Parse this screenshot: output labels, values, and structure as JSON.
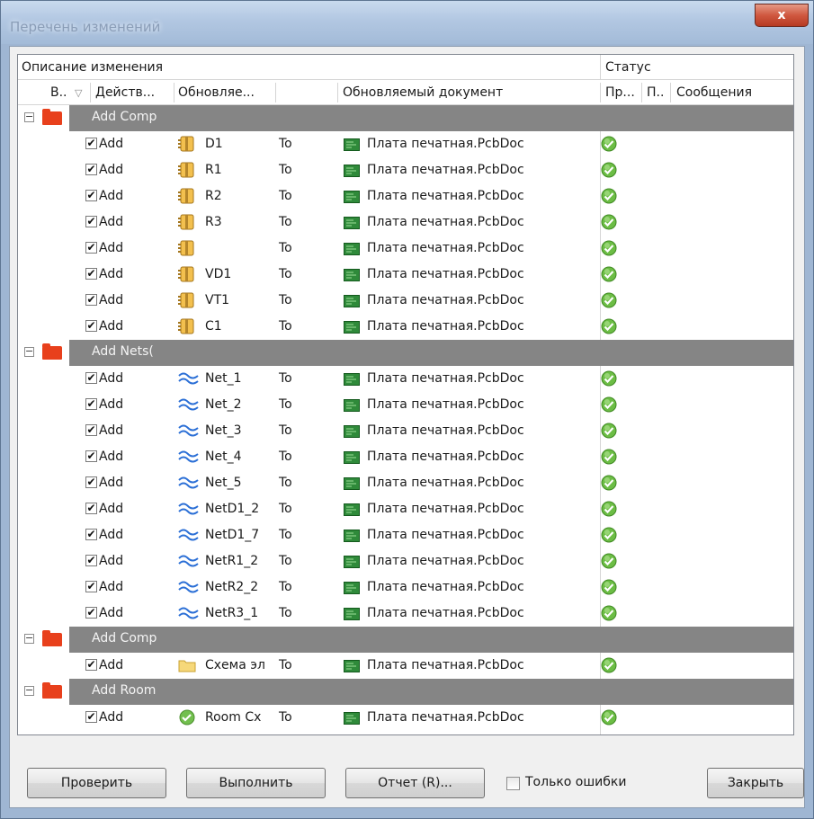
{
  "window": {
    "title": "Перечень изменений",
    "close_glyph": "x"
  },
  "bands": {
    "left": "Описание изменения",
    "right": "Статус"
  },
  "columns": {
    "enable": "В..",
    "sort_glyph": "▽",
    "action": "Действ...",
    "affected_object": "Обновляе...",
    "affected_document": "Обновляемый документ",
    "check": "Пр...",
    "done": "П..",
    "message": "Сообщения"
  },
  "groups": [
    {
      "label": "Add Comp",
      "items": [
        {
          "action": "Add",
          "object": "D1",
          "icon": "component-icon",
          "to": "To",
          "document": "Плата печатная.PcbDoc"
        },
        {
          "action": "Add",
          "object": "R1",
          "icon": "component-icon",
          "to": "To",
          "document": "Плата печатная.PcbDoc"
        },
        {
          "action": "Add",
          "object": "R2",
          "icon": "component-icon",
          "to": "To",
          "document": "Плата печатная.PcbDoc"
        },
        {
          "action": "Add",
          "object": "R3",
          "icon": "component-icon",
          "to": "To",
          "document": "Плата печатная.PcbDoc"
        },
        {
          "action": "Add",
          "object": "",
          "icon": "component-icon",
          "to": "To",
          "document": "Плата печатная.PcbDoc"
        },
        {
          "action": "Add",
          "object": "VD1",
          "icon": "component-icon",
          "to": "To",
          "document": "Плата печатная.PcbDoc"
        },
        {
          "action": "Add",
          "object": "VT1",
          "icon": "component-icon",
          "to": "To",
          "document": "Плата печатная.PcbDoc"
        },
        {
          "action": "Add",
          "object": "C1",
          "icon": "component-icon",
          "to": "To",
          "document": "Плата печатная.PcbDoc"
        }
      ]
    },
    {
      "label": "Add Nets(",
      "items": [
        {
          "action": "Add",
          "object": "Net_1",
          "icon": "net-icon",
          "to": "To",
          "document": "Плата печатная.PcbDoc"
        },
        {
          "action": "Add",
          "object": "Net_2",
          "icon": "net-icon",
          "to": "To",
          "document": "Плата печатная.PcbDoc"
        },
        {
          "action": "Add",
          "object": "Net_3",
          "icon": "net-icon",
          "to": "To",
          "document": "Плата печатная.PcbDoc"
        },
        {
          "action": "Add",
          "object": "Net_4",
          "icon": "net-icon",
          "to": "To",
          "document": "Плата печатная.PcbDoc"
        },
        {
          "action": "Add",
          "object": "Net_5",
          "icon": "net-icon",
          "to": "To",
          "document": "Плата печатная.PcbDoc"
        },
        {
          "action": "Add",
          "object": "NetD1_2",
          "icon": "net-icon",
          "to": "To",
          "document": "Плата печатная.PcbDoc"
        },
        {
          "action": "Add",
          "object": "NetD1_7",
          "icon": "net-icon",
          "to": "To",
          "document": "Плата печатная.PcbDoc"
        },
        {
          "action": "Add",
          "object": "NetR1_2",
          "icon": "net-icon",
          "to": "To",
          "document": "Плата печатная.PcbDoc"
        },
        {
          "action": "Add",
          "object": "NetR2_2",
          "icon": "net-icon",
          "to": "To",
          "document": "Плата печатная.PcbDoc"
        },
        {
          "action": "Add",
          "object": "NetR3_1",
          "icon": "net-icon",
          "to": "To",
          "document": "Плата печатная.PcbDoc"
        }
      ]
    },
    {
      "label": "Add Comp",
      "items": [
        {
          "action": "Add",
          "object": "Схема эл",
          "icon": "folder-icon",
          "to": "To",
          "document": "Плата печатная.PcbDoc"
        }
      ]
    },
    {
      "label": "Add Room",
      "items": [
        {
          "action": "Add",
          "object": "Room Cx",
          "icon": "room-check-icon",
          "to": "To",
          "document": "Плата печатная.PcbDoc"
        }
      ]
    }
  ],
  "footer": {
    "validate": "Проверить",
    "execute": "Выполнить",
    "report": "Отчет (R)...",
    "only_errors": "Только ошибки",
    "close": "Закрыть"
  },
  "colors": {
    "group_bar": "#858585",
    "folder": "#e8401c",
    "ok": "#5cae3c",
    "net": "#2b6fd6",
    "title_bar": "#b2c7e2"
  }
}
